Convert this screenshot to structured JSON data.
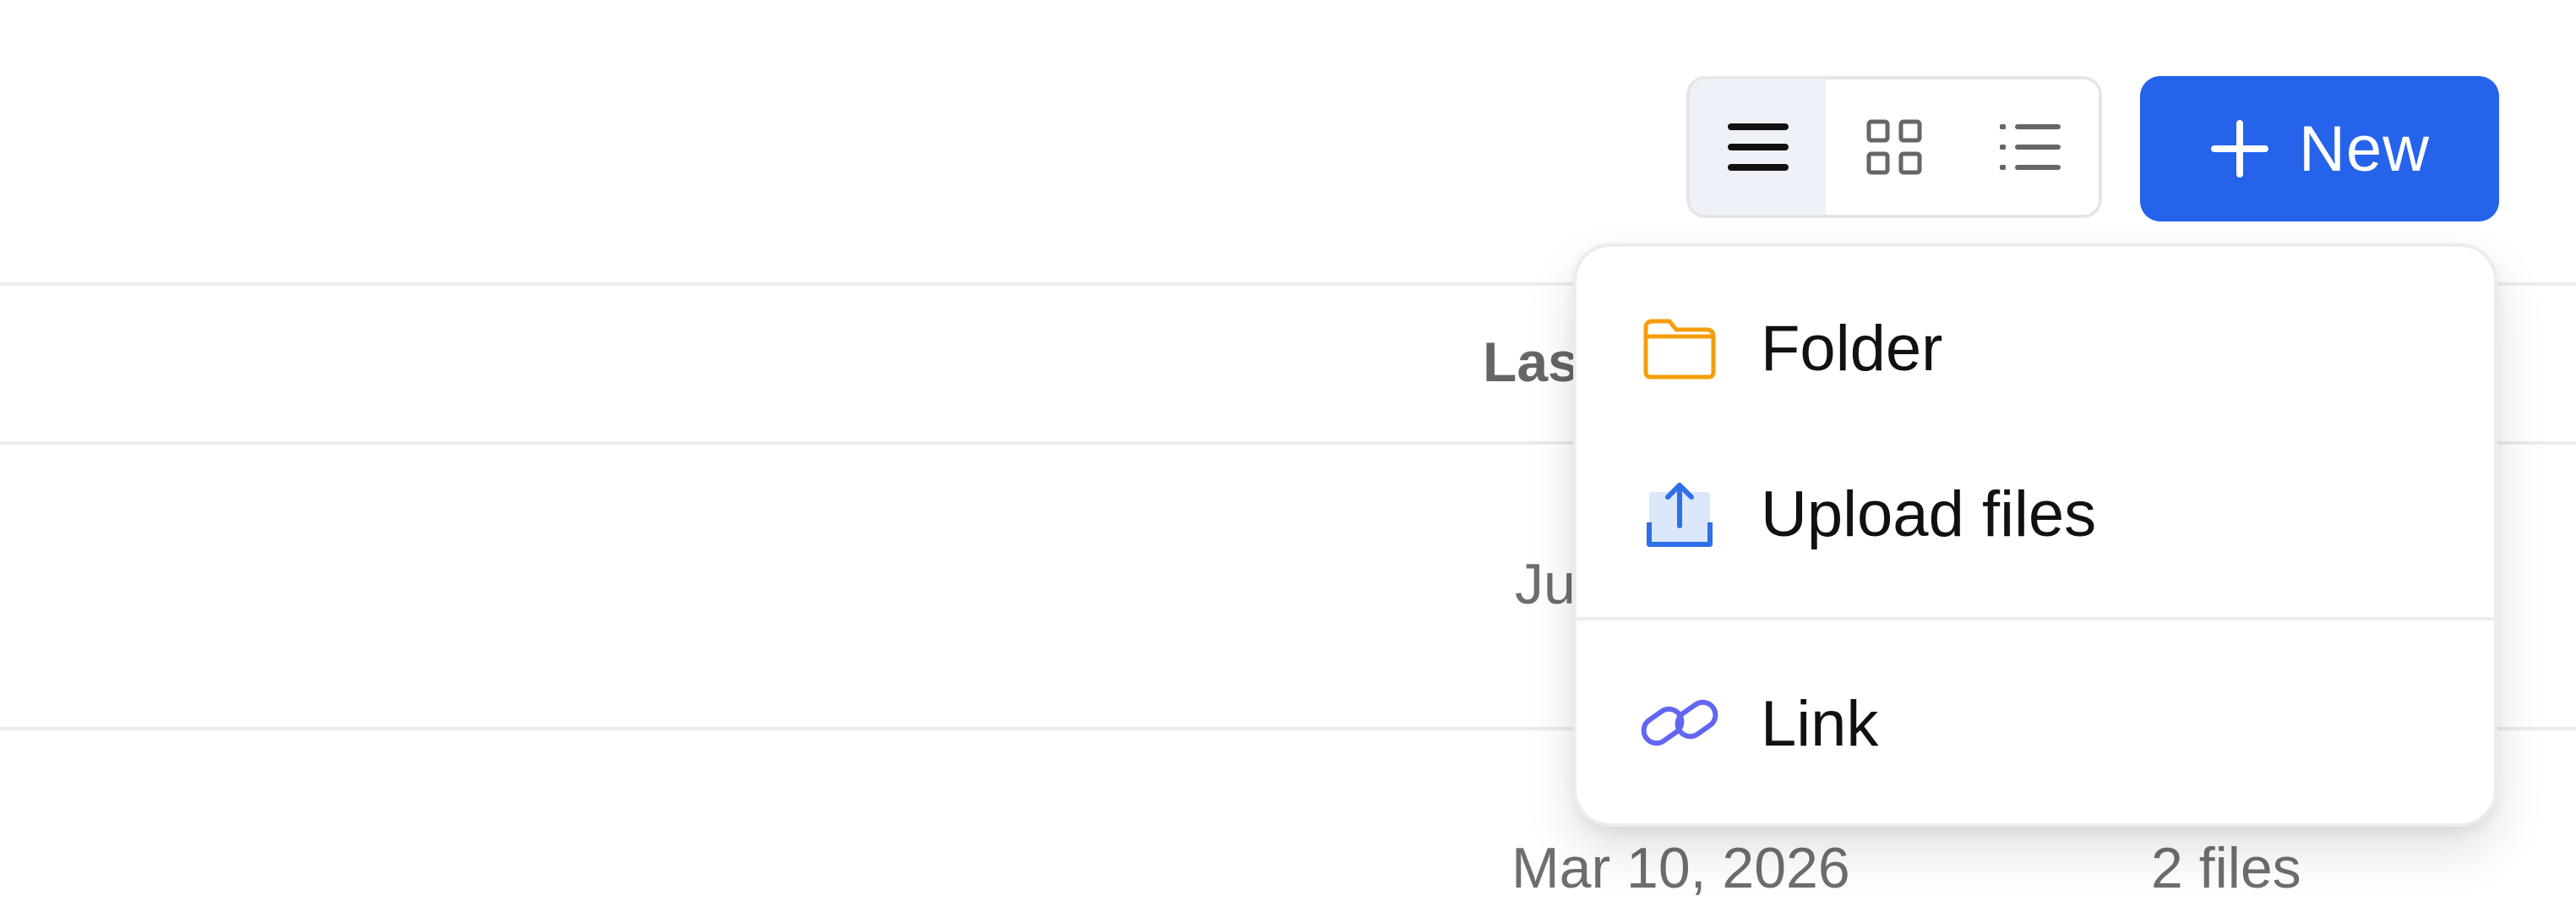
{
  "toolbar": {
    "views": [
      {
        "icon": "menu-lines-icon",
        "active": true
      },
      {
        "icon": "grid-icon",
        "active": false
      },
      {
        "icon": "bullet-list-icon",
        "active": false
      }
    ],
    "new_label": "New",
    "colors": {
      "primary": "#2563eb",
      "folder": "#f59e0b",
      "upload": "#2f6fe8",
      "link": "#6366f1"
    }
  },
  "table": {
    "header_partial": "Las",
    "rows": [
      {
        "date_partial": "Ju"
      },
      {
        "date": "Mar 10, 2026",
        "files": "2 files"
      }
    ]
  },
  "new_menu": {
    "items": [
      {
        "label": "Folder",
        "icon": "folder-icon"
      },
      {
        "label": "Upload files",
        "icon": "upload-icon"
      },
      {
        "label": "Link",
        "icon": "link-icon"
      }
    ]
  }
}
